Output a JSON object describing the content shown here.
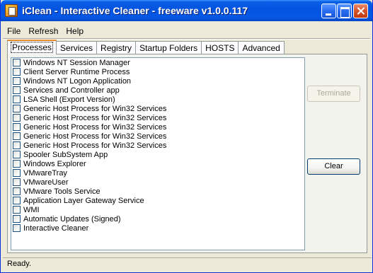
{
  "window": {
    "title": "iClean - Interactive Cleaner - freeware v1.0.0.117"
  },
  "menu": [
    "File",
    "Refresh",
    "Help"
  ],
  "tabs": [
    "Processes",
    "Services",
    "Registry",
    "Startup Folders",
    "HOSTS",
    "Advanced"
  ],
  "active_tab": "Processes",
  "processes": [
    {
      "label": "Windows NT Session Manager",
      "checked": false
    },
    {
      "label": "Client Server Runtime Process",
      "checked": false
    },
    {
      "label": "Windows NT Logon Application",
      "checked": false
    },
    {
      "label": "Services and Controller app",
      "checked": false
    },
    {
      "label": "LSA Shell (Export Version)",
      "checked": false
    },
    {
      "label": "Generic Host Process for Win32 Services",
      "checked": false
    },
    {
      "label": "Generic Host Process for Win32 Services",
      "checked": false
    },
    {
      "label": "Generic Host Process for Win32 Services",
      "checked": false
    },
    {
      "label": "Generic Host Process for Win32 Services",
      "checked": false
    },
    {
      "label": "Generic Host Process for Win32 Services",
      "checked": false
    },
    {
      "label": "Spooler SubSystem App",
      "checked": false
    },
    {
      "label": "Windows Explorer",
      "checked": false
    },
    {
      "label": "VMwareTray",
      "checked": false
    },
    {
      "label": "VMwareUser",
      "checked": false
    },
    {
      "label": "VMware Tools Service",
      "checked": false
    },
    {
      "label": "Application Layer Gateway Service",
      "checked": false
    },
    {
      "label": "WMI",
      "checked": false
    },
    {
      "label": "Automatic Updates (Signed)",
      "checked": false
    },
    {
      "label": "Interactive Cleaner",
      "checked": false
    }
  ],
  "buttons": {
    "terminate": "Terminate",
    "terminate_enabled": false,
    "clear": "Clear"
  },
  "status": "Ready.",
  "colors": {
    "titlebar": "#0454e0",
    "window_bg": "#ece9d8",
    "active_tab_accent": "#e68b2c"
  }
}
